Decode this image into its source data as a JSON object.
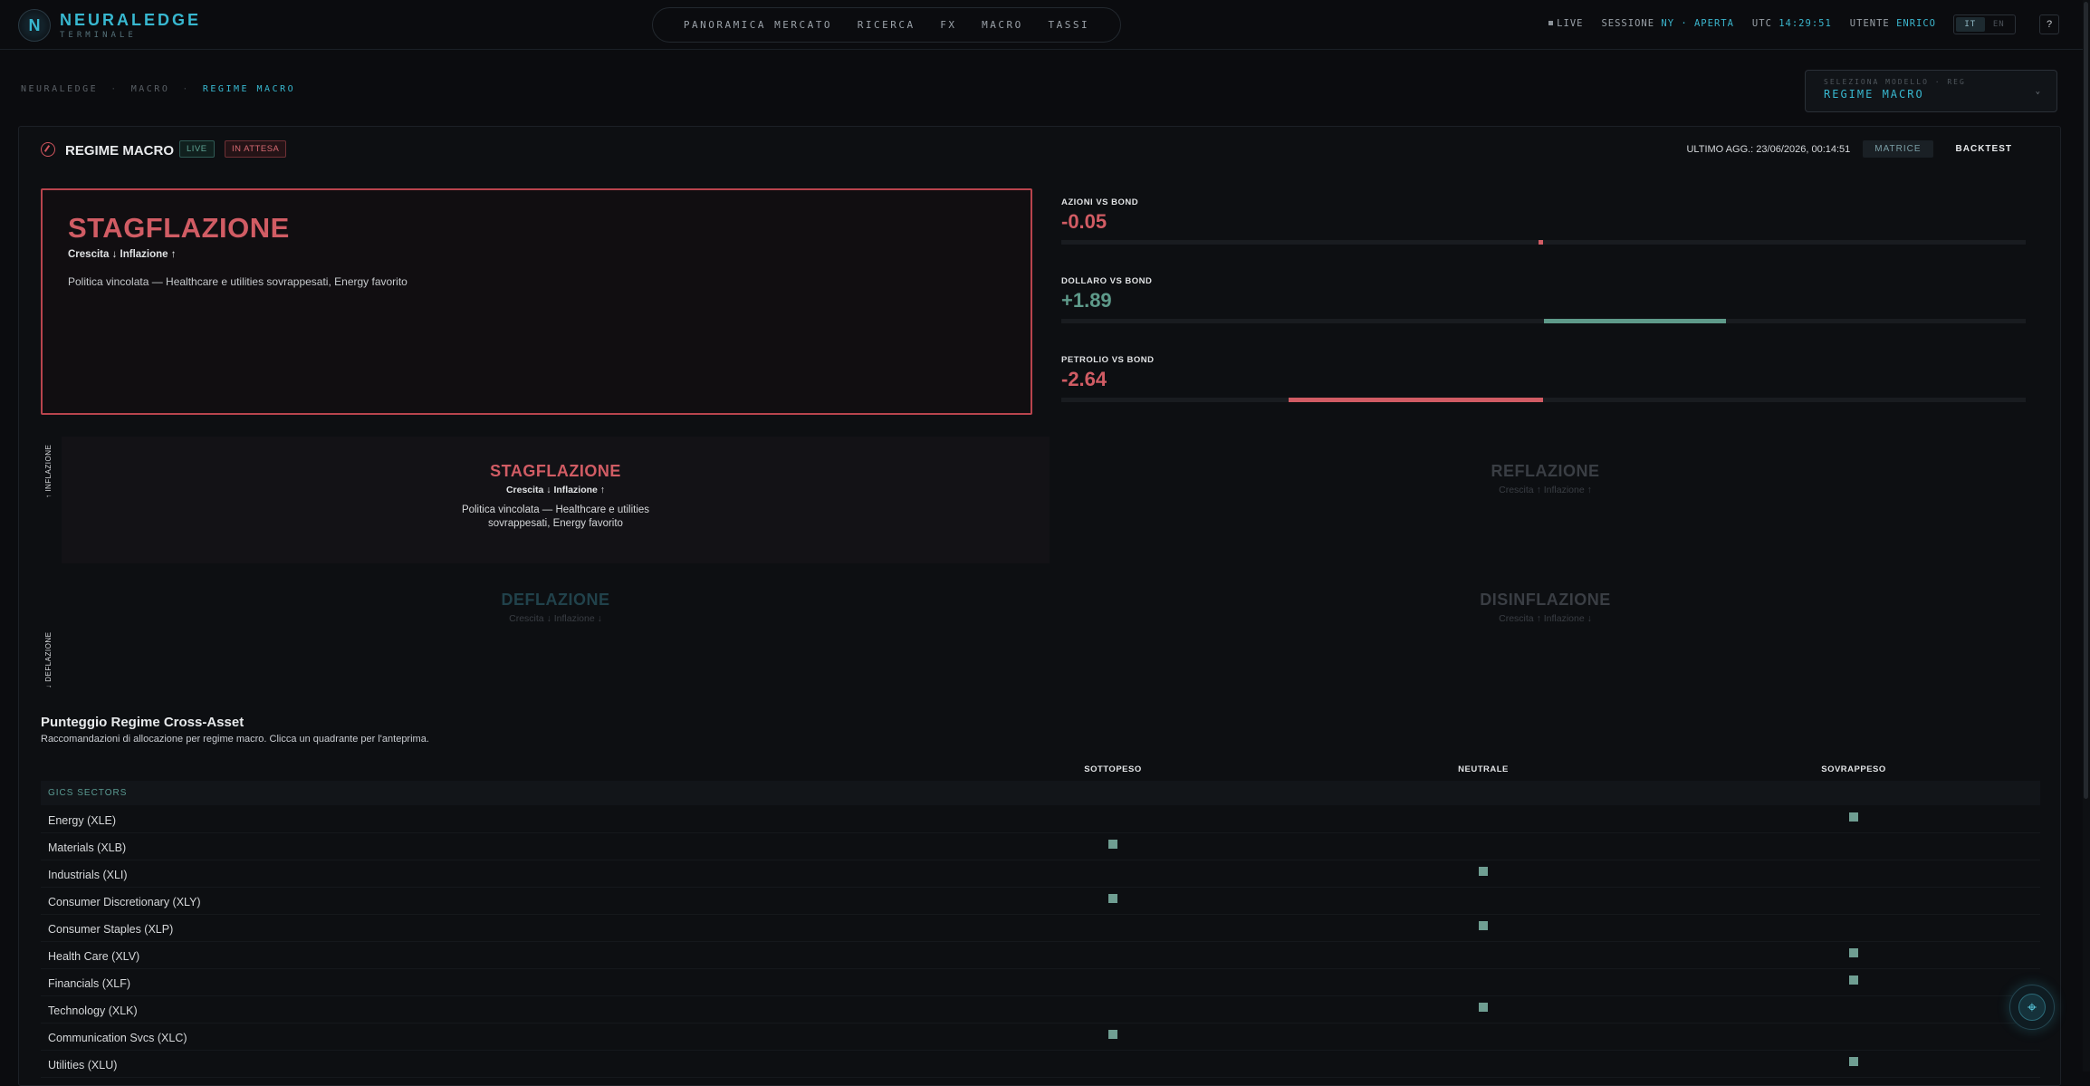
{
  "app": {
    "brand": "NEURALEDGE",
    "brand_sub": "TERMINALE",
    "brand_mark": "N"
  },
  "nav": [
    "PANORAMICA MERCATO",
    "RICERCA",
    "FX",
    "MACRO",
    "TASSI"
  ],
  "status": {
    "live": "LIVE",
    "session_label": "SESSIONE",
    "session_value": "NY · APERTA",
    "utc_label": "UTC",
    "utc_value": "14:29:51",
    "user_label": "UTENTE",
    "user_value": "ENRICO"
  },
  "lang": {
    "it": "IT",
    "en": "EN",
    "selected": "IT"
  },
  "help": "?",
  "breadcrumb": [
    "NEURALEDGE",
    "MACRO",
    "REGIME MACRO"
  ],
  "breadcrumb_sep": "·",
  "model_select": {
    "label": "SELEZIONA MODELLO · REG",
    "value": "REGIME MACRO",
    "chevron": "⌄"
  },
  "panel": {
    "title": "REGIME MACRO",
    "badge_live": "LIVE",
    "badge_wait": "IN ATTESA",
    "updated": "ULTIMO AGG.: 23/06/2026, 00:14:51",
    "btn_matrix": "MATRICE",
    "btn_backtest": "BACKTEST"
  },
  "regime": {
    "name": "STAGFLAZIONE",
    "sub": "Crescita ↓ Inflazione ↑",
    "desc": "Politica vincolata — Healthcare e utilities sovrappesati, Energy favorito"
  },
  "spreads": [
    {
      "label": "AZIONI VS BOND",
      "value": "-0.05",
      "num": -0.05
    },
    {
      "label": "DOLLARO VS BOND",
      "value": "+1.89",
      "num": 1.89
    },
    {
      "label": "PETROLIO VS BOND",
      "value": "-2.64",
      "num": -2.64
    }
  ],
  "axis": {
    "up": "↑ INFLAZIONE",
    "down": "↓ DEFLAZIONE"
  },
  "quadrants": {
    "stagflation": {
      "name": "STAGFLAZIONE",
      "sub": "Crescita ↓ Inflazione ↑",
      "desc": "Politica vincolata — Healthcare e utilities sovrappesati, Energy favorito"
    },
    "reflation": {
      "name": "REFLAZIONE",
      "sub": "Crescita ↑ Inflazione ↑"
    },
    "deflation": {
      "name": "DEFLAZIONE",
      "sub": "Crescita ↓ Inflazione ↓"
    },
    "disinflation": {
      "name": "DISINFLAZIONE",
      "sub": "Crescita ↑ Inflazione ↓"
    }
  },
  "scores": {
    "title": "Punteggio Regime Cross-Asset",
    "subtitle": "Raccomandazioni di allocazione per regime macro. Clicca un quadrante per l'anteprima.",
    "columns": [
      "SOTTOPESO",
      "NEUTRALE",
      "SOVRAPPESO"
    ],
    "group": "GICS SECTORS",
    "rows": [
      {
        "name": "Energy (XLE)",
        "rec": "SOVRAPPESO"
      },
      {
        "name": "Materials (XLB)",
        "rec": "SOTTOPESO"
      },
      {
        "name": "Industrials (XLI)",
        "rec": "NEUTRALE"
      },
      {
        "name": "Consumer Discretionary (XLY)",
        "rec": "SOTTOPESO"
      },
      {
        "name": "Consumer Staples (XLP)",
        "rec": "NEUTRALE"
      },
      {
        "name": "Health Care (XLV)",
        "rec": "SOVRAPPESO"
      },
      {
        "name": "Financials (XLF)",
        "rec": "SOVRAPPESO"
      },
      {
        "name": "Technology (XLK)",
        "rec": "NEUTRALE"
      },
      {
        "name": "Communication Svcs (XLC)",
        "rec": "SOTTOPESO"
      },
      {
        "name": "Utilities (XLU)",
        "rec": "SOVRAPPESO"
      }
    ]
  },
  "fab_icon": "⌖",
  "colors": {
    "accent": "#38b8d0",
    "negative": "#d15c64",
    "positive": "#5e9a8a",
    "marker": "#6f9e92"
  }
}
